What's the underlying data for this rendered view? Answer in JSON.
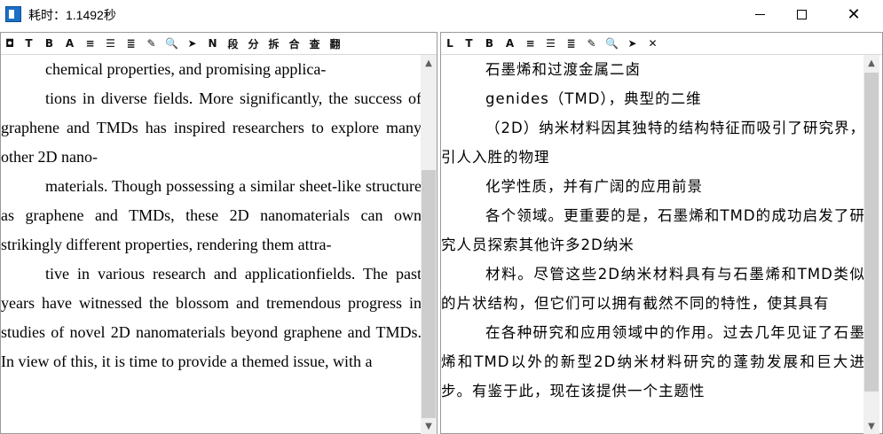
{
  "window": {
    "title": "耗时：1.1492秒",
    "minimize_label": "",
    "maximize_label": "",
    "close_label": "✕"
  },
  "left_toolbar": [
    "◘",
    "T",
    "B",
    "A",
    "≡",
    "☰",
    "≣",
    "✎",
    "🔍",
    "➤",
    "N",
    "段",
    "分",
    "拆",
    "合",
    "查",
    "翻"
  ],
  "right_toolbar": [
    "L",
    "T",
    "B",
    "A",
    "≡",
    "☰",
    "≣",
    "✎",
    "🔍",
    "➤",
    "✕"
  ],
  "left_text": [
    {
      "indent": true,
      "text": "chemical properties, and promising applica-"
    },
    {
      "indent": true,
      "text": "tions in diverse fields. More significantly, the success of graphene and TMDs has inspired researchers to explore many other 2D nano-"
    },
    {
      "indent": true,
      "text": "materials. Though possessing a similar sheet-like structure as graphene and TMDs, these 2D nanomaterials can own strikingly different properties, rendering them attra-"
    },
    {
      "indent": true,
      "text": "tive in various research and applicationfields. The past years have witnessed the blossom and tremendous progress in studies of novel 2D nanomaterials beyond graphene and TMDs. In view of this, it is time to provide a themed issue, with a"
    }
  ],
  "right_text": [
    {
      "indent": true,
      "text": "石墨烯和过渡金属二卤"
    },
    {
      "indent": true,
      "text": "genides（TMD），典型的二维"
    },
    {
      "indent": true,
      "text": "（2D）纳米材料因其独特的结构特征而吸引了研究界，引人入胜的物理"
    },
    {
      "indent": true,
      "text": "化学性质，并有广阔的应用前景"
    },
    {
      "indent": true,
      "text": "各个领域。更重要的是，石墨烯和TMD的成功启发了研究人员探索其他许多2D纳米"
    },
    {
      "indent": true,
      "text": "材料。尽管这些2D纳米材料具有与石墨烯和TMD类似的片状结构，但它们可以拥有截然不同的特性，使其具有"
    },
    {
      "indent": true,
      "text": "在各种研究和应用领域中的作用。过去几年见证了石墨烯和TMD以外的新型2D纳米材料研究的蓬勃发展和巨大进步。有鉴于此，现在该提供一个主题性"
    }
  ],
  "scrollbar": {
    "up": "▲",
    "down": "▼"
  }
}
